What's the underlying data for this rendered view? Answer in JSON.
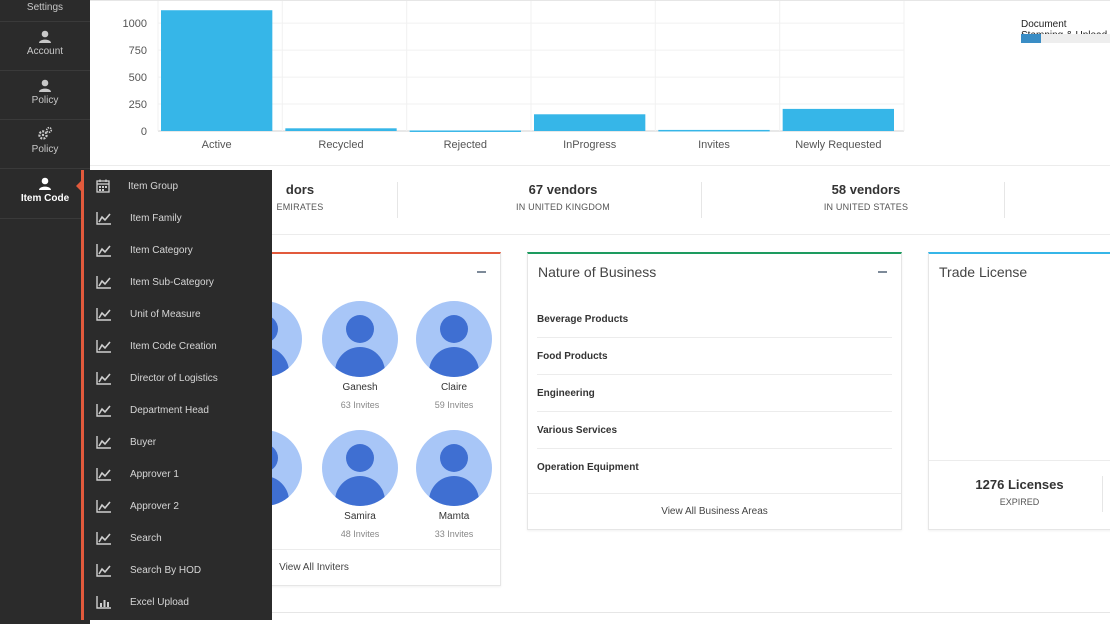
{
  "sidebar": {
    "items": [
      {
        "label": "Settings",
        "icon": "gear-icon"
      },
      {
        "label": "Account",
        "icon": "user-icon"
      },
      {
        "label": "Policy",
        "icon": "user-icon"
      },
      {
        "label": "Policy",
        "icon": "gears-icon"
      },
      {
        "label": "Item Code",
        "icon": "user-icon",
        "active": true
      }
    ]
  },
  "flyout": {
    "items": [
      {
        "label": "Item Group",
        "icon": "calendar-icon"
      },
      {
        "label": "Item Family",
        "icon": "line-chart-icon"
      },
      {
        "label": "Item Category",
        "icon": "line-chart-icon"
      },
      {
        "label": "Item Sub-Category",
        "icon": "line-chart-icon"
      },
      {
        "label": "Unit of Measure",
        "icon": "line-chart-icon"
      },
      {
        "label": "Item Code Creation",
        "icon": "line-chart-icon"
      },
      {
        "label": "Director of Logistics",
        "icon": "line-chart-icon"
      },
      {
        "label": "Department Head",
        "icon": "line-chart-icon"
      },
      {
        "label": "Buyer",
        "icon": "line-chart-icon"
      },
      {
        "label": "Approver 1",
        "icon": "line-chart-icon"
      },
      {
        "label": "Approver 2",
        "icon": "line-chart-icon"
      },
      {
        "label": "Search",
        "icon": "line-chart-icon"
      },
      {
        "label": "Search By HOD",
        "icon": "line-chart-icon"
      },
      {
        "label": "Excel Upload",
        "icon": "bar-chart-icon"
      }
    ],
    "accent_color": "#e25a3c"
  },
  "chart_data": {
    "type": "bar",
    "categories": [
      "Active",
      "Recycled",
      "Rejected",
      "InProgress",
      "Invites",
      "Newly Requested"
    ],
    "values": [
      1120,
      25,
      5,
      155,
      10,
      205
    ],
    "yticks": [
      0,
      250,
      500,
      750,
      1000
    ],
    "ylim": [
      0,
      1150
    ],
    "grid": true,
    "color": "#36b6e8",
    "title": "",
    "xlabel": "",
    "ylabel": ""
  },
  "legend": {
    "label": "Document Stamping & Upload",
    "progress_fraction": 0.11,
    "color": "#3a8dc5"
  },
  "vendor_stats": [
    {
      "value": "dors",
      "caption": "EMIRATES"
    },
    {
      "value": "67 vendors",
      "caption": "IN UNITED KINGDOM"
    },
    {
      "value": "58 vendors",
      "caption": "IN UNITED STATES"
    }
  ],
  "inviters_card": {
    "accent_color": "#e25a3c",
    "people": [
      {
        "name": "bek",
        "invites": "ites"
      },
      {
        "name": "Ganesh",
        "invites": "63 Invites"
      },
      {
        "name": "Claire",
        "invites": "59 Invites"
      },
      {
        "name": "kur",
        "invites": "ites"
      },
      {
        "name": "Samira",
        "invites": "48 Invites"
      },
      {
        "name": "Mamta",
        "invites": "33 Invites"
      }
    ],
    "footer": "View All Inviters"
  },
  "business_card": {
    "title": "Nature of Business",
    "accent_color": "#1d9b5f",
    "items": [
      "Beverage Products",
      "Food Products",
      "Engineering",
      "Various Services",
      "Operation Equipment"
    ],
    "footer": "View All Business Areas"
  },
  "license_card": {
    "title": "Trade License",
    "accent_color": "#36b6e8",
    "stat_value": "1276 Licenses",
    "stat_caption": "EXPIRED"
  }
}
